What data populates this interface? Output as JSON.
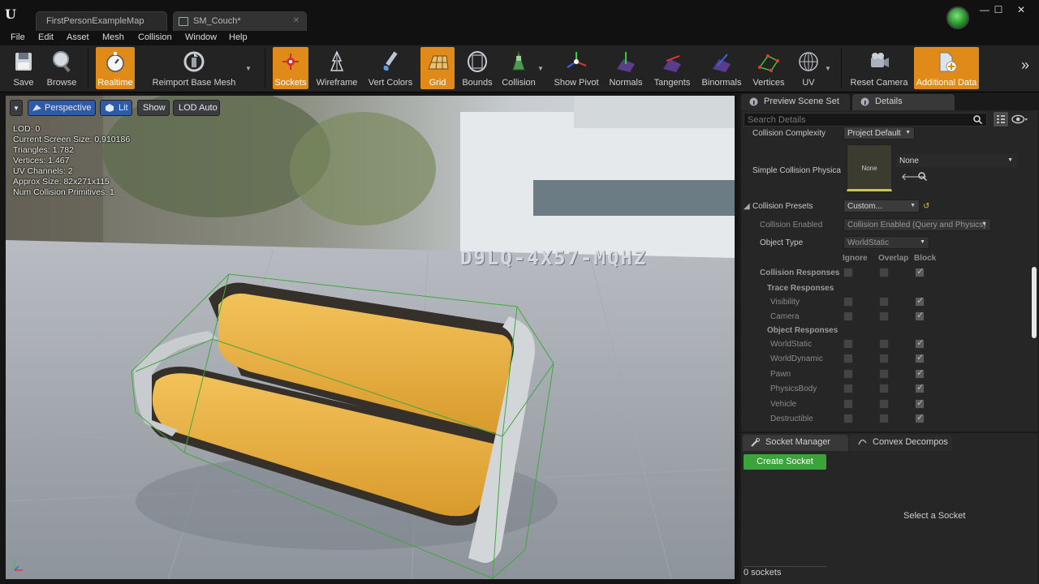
{
  "window": {
    "tabs": [
      {
        "label": "FirstPersonExampleMap"
      },
      {
        "label": "SM_Couch*"
      }
    ],
    "controls": {
      "minimize": "—",
      "maximize": "☐",
      "close": "✕"
    }
  },
  "menu": [
    "File",
    "Edit",
    "Asset",
    "Mesh",
    "Collision",
    "Window",
    "Help"
  ],
  "toolbar": {
    "save": "Save",
    "browse": "Browse",
    "realtime": "Realtime",
    "reimport": "Reimport Base Mesh",
    "sockets": "Sockets",
    "wireframe": "Wireframe",
    "vert_colors": "Vert Colors",
    "grid": "Grid",
    "bounds": "Bounds",
    "collision": "Collision",
    "show_pivot": "Show Pivot",
    "normals": "Normals",
    "tangents": "Tangents",
    "binormals": "Binormals",
    "vertices": "Vertices",
    "uv": "UV",
    "reset_camera": "Reset Camera",
    "additional_data": "Additional Data",
    "overflow": "»"
  },
  "viewport": {
    "perspective": "Perspective",
    "lit": "Lit",
    "show": "Show",
    "lod": "LOD Auto",
    "stats": [
      "LOD:  0",
      "Current Screen Size:  0,910186",
      "Triangles:  1.782",
      "Vertices:  1.467",
      "UV Channels:  2",
      "Approx Size: 82x271x115",
      "Num Collision Primitives:  1"
    ],
    "watermark": "D9LQ-4X57-MQHZ"
  },
  "details_tabs": {
    "preview": "Preview Scene Set",
    "details": "Details"
  },
  "details": {
    "search_placeholder": "Search Details",
    "collision_complexity_label": "Collision Complexity",
    "collision_complexity_value": "Project Default",
    "simple_collision_label": "Simple Collision Physica",
    "simple_collision_thumb": "None",
    "simple_collision_value": "None",
    "collision_presets_label": "Collision Presets",
    "collision_presets_value": "Custom...",
    "collision_enabled_label": "Collision Enabled",
    "collision_enabled_value": "Collision Enabled (Query and Physics)",
    "object_type_label": "Object Type",
    "object_type_value": "WorldStatic",
    "col_ignore": "Ignore",
    "col_overlap": "Overlap",
    "col_block": "Block",
    "collision_responses": "Collision Responses",
    "trace_responses": "Trace Responses",
    "object_responses": "Object Responses",
    "responses": [
      {
        "label": "Visibility"
      },
      {
        "label": "Camera"
      },
      {
        "label": "WorldStatic"
      },
      {
        "label": "WorldDynamic"
      },
      {
        "label": "Pawn"
      },
      {
        "label": "PhysicsBody"
      },
      {
        "label": "Vehicle"
      },
      {
        "label": "Destructible"
      }
    ]
  },
  "socket_tabs": {
    "socket_manager": "Socket Manager",
    "convex": "Convex Decompos"
  },
  "socket": {
    "create": "Create Socket",
    "select": "Select a Socket",
    "count": "0 sockets"
  },
  "colors": {
    "accent_orange": "#e08a1a",
    "create_green": "#3aa43a",
    "lit_blue": "#2e5aa8"
  }
}
